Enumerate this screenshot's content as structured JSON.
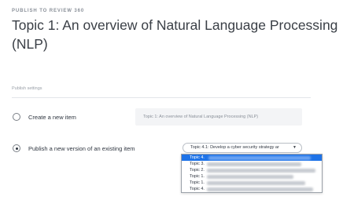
{
  "header": {
    "kicker": "PUBLISH TO REVIEW 360",
    "title": "Topic 1: An overview of Natural Language Processing (NLP)"
  },
  "settings": {
    "section_label": "Publish settings",
    "create_option": {
      "label": "Create a new item",
      "selected": false,
      "name_value": "Topic 1: An overview of Natural Language Processing (NLP)"
    },
    "version_option": {
      "label": "Publish a new version of an existing item",
      "selected": true,
      "select_value": "Topic 4.1: Develop a cyber security strategy ar",
      "caret_icon": "chevron-down-icon"
    }
  },
  "dropdown": {
    "options": [
      {
        "label": "Topic 4.",
        "selected": true
      },
      {
        "label": "Topic 3.",
        "selected": false
      },
      {
        "label": "Topic 2.",
        "selected": false
      },
      {
        "label": "Topic 1.",
        "selected": false
      },
      {
        "label": "Topic 1.",
        "selected": false
      },
      {
        "label": "Topic 4.",
        "selected": false
      }
    ],
    "highlight_color": "#1e73e8"
  }
}
